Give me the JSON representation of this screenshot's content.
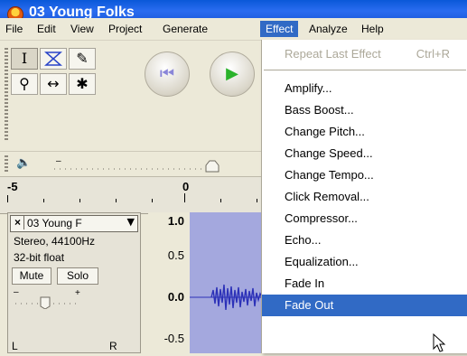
{
  "window": {
    "title": "03 Young Folks"
  },
  "menubar": {
    "items": [
      {
        "label": "File",
        "active": false
      },
      {
        "label": "Edit",
        "active": false
      },
      {
        "label": "View",
        "active": false
      },
      {
        "label": "Project",
        "active": false
      },
      {
        "label": "Generate",
        "active": false
      },
      {
        "label": "Effect",
        "active": true
      },
      {
        "label": "Analyze",
        "active": false
      },
      {
        "label": "Help",
        "active": false
      }
    ]
  },
  "tools": {
    "selection": "I",
    "envelope": "envelope",
    "draw": "✎",
    "zoom": "⚲",
    "timeshift": "↔",
    "multi": "✱"
  },
  "transport": {
    "skip_start": "⏮",
    "play": "▶"
  },
  "ruler": {
    "labels": [
      "-5",
      "0"
    ]
  },
  "track": {
    "name": "03 Young F",
    "format": "Stereo, 44100Hz",
    "bitdepth": "32-bit float",
    "mute": "Mute",
    "solo": "Solo",
    "pan_left": "L",
    "pan_right": "R",
    "scale": [
      "1.0",
      "0.5",
      "0.0",
      "-0.5"
    ]
  },
  "effect_menu": {
    "repeat": {
      "label": "Repeat Last Effect",
      "shortcut": "Ctrl+R",
      "enabled": false
    },
    "items": [
      "Amplify...",
      "Bass Boost...",
      "Change Pitch...",
      "Change Speed...",
      "Change Tempo...",
      "Click Removal...",
      "Compressor...",
      "Echo...",
      "Equalization...",
      "Fade In",
      "Fade Out"
    ],
    "highlighted": "Fade Out"
  },
  "colors": {
    "titlebar": "#0a58d8",
    "menu_highlight": "#316ac5",
    "waveform_bg": "#a4a8de",
    "waveform": "#2c31b8",
    "play_green": "#2bb32b"
  }
}
